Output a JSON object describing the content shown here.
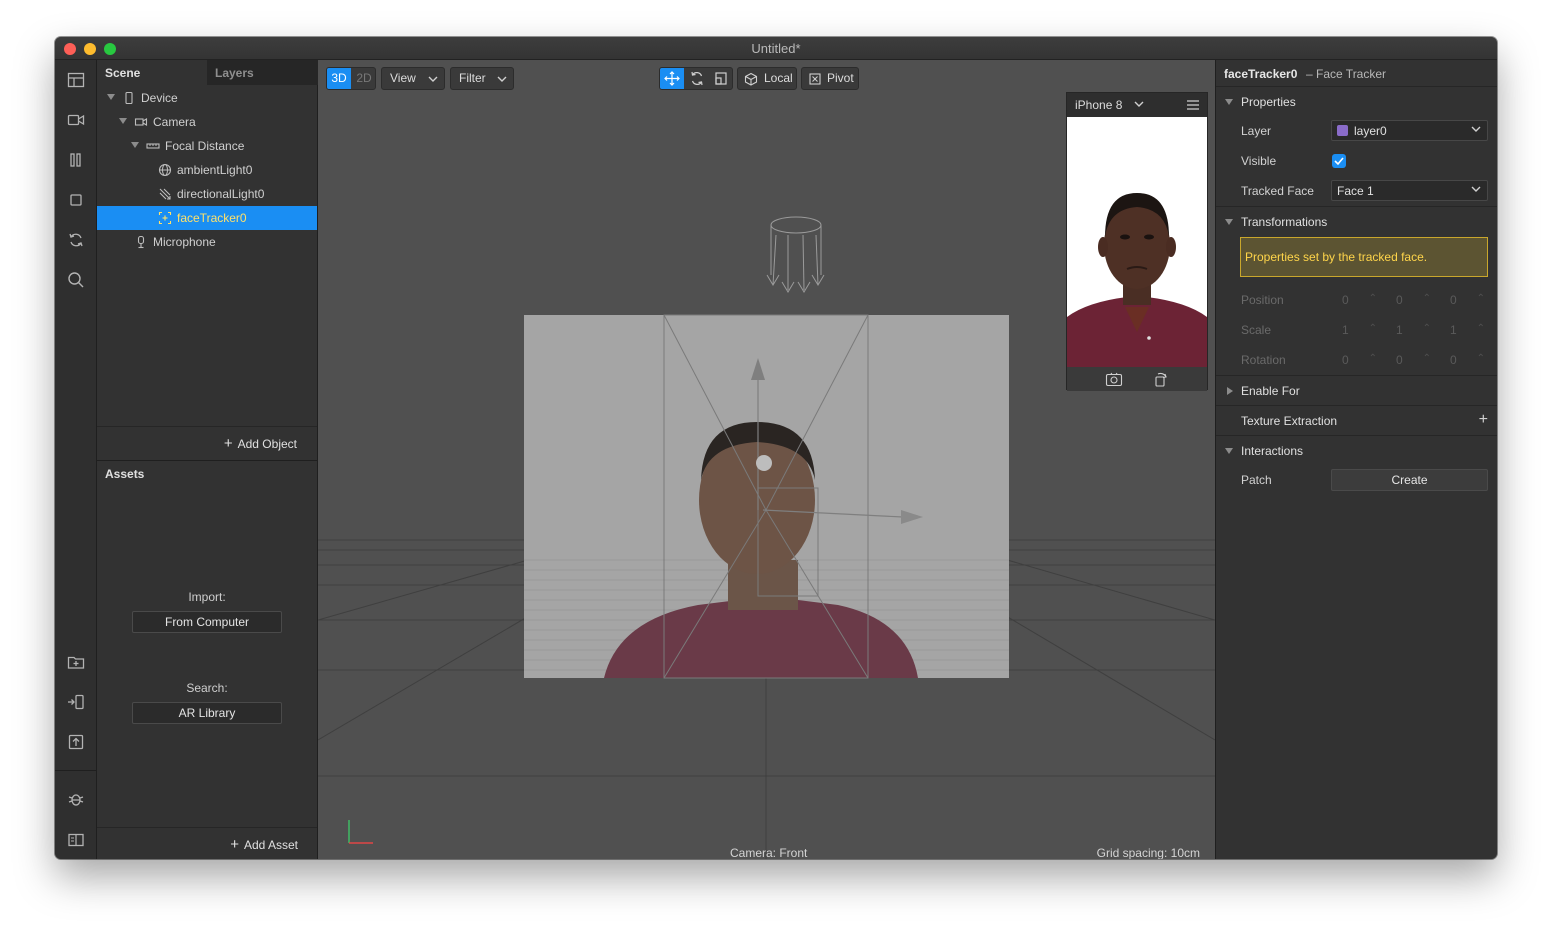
{
  "window": {
    "title": "Untitled*"
  },
  "scene_panel": {
    "tabs": [
      "Scene",
      "Layers"
    ],
    "tree": [
      {
        "label": "Device",
        "icon": "phone-icon"
      },
      {
        "label": "Camera",
        "icon": "video-camera-icon"
      },
      {
        "label": "Focal Distance",
        "icon": "ruler-icon"
      },
      {
        "label": "ambientLight0",
        "icon": "globe-icon"
      },
      {
        "label": "directionalLight0",
        "icon": "directional-light-icon"
      },
      {
        "label": "faceTracker0",
        "icon": "face-tracker-icon"
      },
      {
        "label": "Microphone",
        "icon": "microphone-icon"
      }
    ],
    "add_object": "Add Object"
  },
  "assets_panel": {
    "title": "Assets",
    "import_label": "Import:",
    "from_computer": "From Computer",
    "search_label": "Search:",
    "ar_library": "AR Library",
    "add_asset": "Add Asset"
  },
  "viewport": {
    "toolbar": {
      "mode_3d": "3D",
      "mode_2d": "2D",
      "view": "View",
      "filter": "Filter",
      "local": "Local",
      "pivot": "Pivot"
    },
    "camera_label": "Camera: Front",
    "grid_label": "Grid spacing: 10cm",
    "simulator": {
      "device": "iPhone 8"
    }
  },
  "inspector": {
    "name": "faceTracker0",
    "type": "– Face Tracker",
    "properties_title": "Properties",
    "layer_label": "Layer",
    "layer_value": "layer0",
    "layer_color": "#8a6cc9",
    "visible_label": "Visible",
    "visible": true,
    "tracked_face_label": "Tracked Face",
    "tracked_face_value": "Face 1",
    "transformations_title": "Transformations",
    "notice": "Properties set by the tracked face.",
    "position_label": "Position",
    "position": [
      "0",
      "0",
      "0"
    ],
    "scale_label": "Scale",
    "scale": [
      "1",
      "1",
      "1"
    ],
    "rotation_label": "Rotation",
    "rotation": [
      "0",
      "0",
      "0"
    ],
    "enable_for_title": "Enable For",
    "texture_extraction_title": "Texture Extraction",
    "interactions_title": "Interactions",
    "patch_label": "Patch",
    "create_button": "Create"
  },
  "colors": {
    "selection": "#1a8ef3",
    "selection_text": "#ffe16a",
    "notice_bg": "#5c5432",
    "notice_border": "#c9a72c",
    "notice_text": "#ffd54a"
  }
}
